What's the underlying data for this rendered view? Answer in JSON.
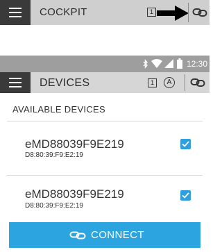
{
  "cockpit": {
    "title": "COCKPIT",
    "page_indicator": "1"
  },
  "status": {
    "time": "12:30"
  },
  "devices_bar": {
    "title": "DEVICES",
    "page_indicator": "1",
    "mode_indicator": "A"
  },
  "section": {
    "title": "AVAILABLE DEVICES"
  },
  "devices": [
    {
      "name": "eMD88039F9E219",
      "mac": "D8:80:39:F9:E2:19",
      "checked": true
    },
    {
      "name": "eMD88039F9E219",
      "mac": "D8:80:39:F9:E2:19",
      "checked": true
    }
  ],
  "connect_button": {
    "label": "CONNECT"
  },
  "colors": {
    "accent": "#2ba4e0",
    "toolbar_dark": "#3a3a3a",
    "status_bar": "#9e9e9e"
  }
}
